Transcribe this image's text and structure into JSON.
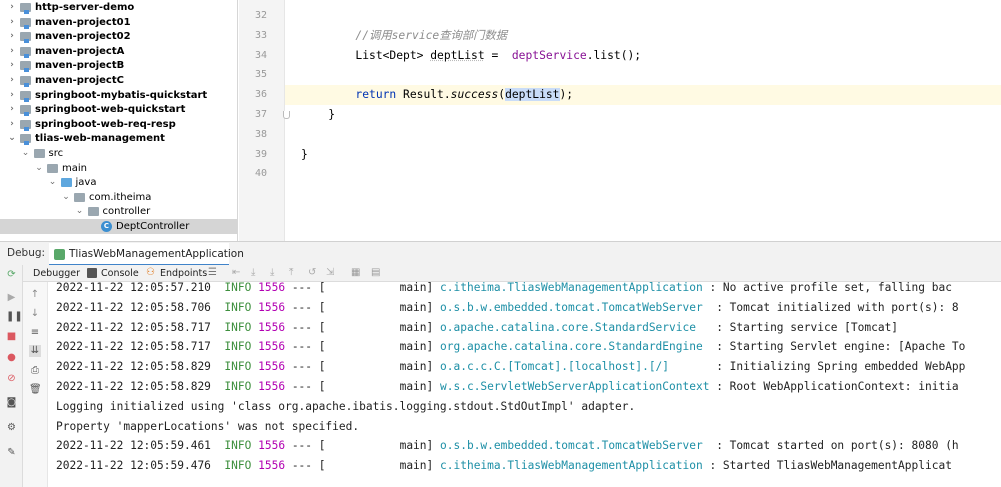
{
  "project_tree": {
    "items": [
      {
        "label": "http-server-demo",
        "kind": "module",
        "level": 0,
        "expanded": false
      },
      {
        "label": "maven-project01",
        "kind": "module",
        "level": 0,
        "expanded": false
      },
      {
        "label": "maven-project02",
        "kind": "module",
        "level": 0,
        "expanded": false
      },
      {
        "label": "maven-projectA",
        "kind": "module",
        "level": 0,
        "expanded": false
      },
      {
        "label": "maven-projectB",
        "kind": "module",
        "level": 0,
        "expanded": false
      },
      {
        "label": "maven-projectC",
        "kind": "module",
        "level": 0,
        "expanded": false
      },
      {
        "label": "springboot-mybatis-quickstart",
        "kind": "module",
        "level": 0,
        "expanded": false
      },
      {
        "label": "springboot-web-quickstart",
        "kind": "module",
        "level": 0,
        "expanded": false
      },
      {
        "label": "springboot-web-req-resp",
        "kind": "module",
        "level": 0,
        "expanded": false
      },
      {
        "label": "tlias-web-management",
        "kind": "module",
        "level": 0,
        "expanded": true
      },
      {
        "label": "src",
        "kind": "folder",
        "level": 1,
        "expanded": true
      },
      {
        "label": "main",
        "kind": "folder",
        "level": 2,
        "expanded": true
      },
      {
        "label": "java",
        "kind": "source-folder",
        "level": 3,
        "expanded": true
      },
      {
        "label": "com.itheima",
        "kind": "package",
        "level": 4,
        "expanded": true
      },
      {
        "label": "controller",
        "kind": "package",
        "level": 5,
        "expanded": true
      },
      {
        "label": "DeptController",
        "kind": "class",
        "level": 6,
        "selected": true
      }
    ]
  },
  "editor": {
    "lines": [
      {
        "no": "32",
        "parts": []
      },
      {
        "no": "33",
        "parts": [
          {
            "t": "        "
          },
          {
            "t": "//调用service查询部门数据",
            "c": "cm"
          }
        ]
      },
      {
        "no": "34",
        "parts": [
          {
            "t": "        List<Dept> "
          },
          {
            "t": "deptList",
            "c": "u"
          },
          {
            "t": " =  "
          },
          {
            "t": "deptService",
            "c": "field"
          },
          {
            "t": ".list();"
          }
        ]
      },
      {
        "no": "35",
        "parts": []
      },
      {
        "no": "36",
        "current": true,
        "parts": [
          {
            "t": "        "
          },
          {
            "t": "return",
            "c": "kw"
          },
          {
            "t": " Result."
          },
          {
            "t": "success",
            "c": "fn-i"
          },
          {
            "t": "("
          },
          {
            "t": "deptList",
            "c": "hl"
          },
          {
            "t": ");"
          }
        ]
      },
      {
        "no": "37",
        "parts": [
          {
            "t": "    }"
          }
        ]
      },
      {
        "no": "38",
        "parts": []
      },
      {
        "no": "39",
        "parts": [
          {
            "t": "}"
          }
        ]
      },
      {
        "no": "40",
        "parts": []
      }
    ]
  },
  "debug": {
    "title": "Debug:",
    "session_tab": "TliasWebManagementApplication",
    "toolbar_tabs": [
      "Debugger",
      "Console",
      "Endpoints"
    ]
  },
  "console": {
    "lines": [
      {
        "ts": "2022-11-22 12:05:57.210",
        "level": "INFO",
        "pid": "1556",
        "thread": "--- [           main]",
        "logger": "c.itheima.TliasWebManagementApplication",
        "msg": ": No active profile set, falling bac"
      },
      {
        "ts": "2022-11-22 12:05:58.706",
        "level": "INFO",
        "pid": "1556",
        "thread": "--- [           main]",
        "logger": "o.s.b.w.embedded.tomcat.TomcatWebServer ",
        "msg": ": Tomcat initialized with port(s): 8"
      },
      {
        "ts": "2022-11-22 12:05:58.717",
        "level": "INFO",
        "pid": "1556",
        "thread": "--- [           main]",
        "logger": "o.apache.catalina.core.StandardService  ",
        "msg": ": Starting service [Tomcat]"
      },
      {
        "ts": "2022-11-22 12:05:58.717",
        "level": "INFO",
        "pid": "1556",
        "thread": "--- [           main]",
        "logger": "org.apache.catalina.core.StandardEngine ",
        "msg": ": Starting Servlet engine: [Apache To"
      },
      {
        "ts": "2022-11-22 12:05:58.829",
        "level": "INFO",
        "pid": "1556",
        "thread": "--- [           main]",
        "logger": "o.a.c.c.C.[Tomcat].[localhost].[/]      ",
        "msg": ": Initializing Spring embedded WebApp"
      },
      {
        "ts": "2022-11-22 12:05:58.829",
        "level": "INFO",
        "pid": "1556",
        "thread": "--- [           main]",
        "logger": "w.s.c.ServletWebServerApplicationContext",
        "msg": ": Root WebApplicationContext: initia"
      },
      {
        "plain": "Logging initialized using 'class org.apache.ibatis.logging.stdout.StdOutImpl' adapter."
      },
      {
        "plain": "Property 'mapperLocations' was not specified."
      },
      {
        "ts": "2022-11-22 12:05:59.461",
        "level": "INFO",
        "pid": "1556",
        "thread": "--- [           main]",
        "logger": "o.s.b.w.embedded.tomcat.TomcatWebServer ",
        "msg": ": Tomcat started on port(s): 8080 (h"
      },
      {
        "ts": "2022-11-22 12:05:59.476",
        "level": "INFO",
        "pid": "1556",
        "thread": "--- [           main]",
        "logger": "c.itheima.TliasWebManagementApplication",
        "msg": ": Started TliasWebManagementApplicat"
      }
    ]
  },
  "colors": {
    "info": "#3d8f3d",
    "pid": "#b200b2",
    "logger": "#1d8fa6",
    "keyword": "#0033b3",
    "field": "#871094",
    "selection": "#c9dcf8"
  }
}
